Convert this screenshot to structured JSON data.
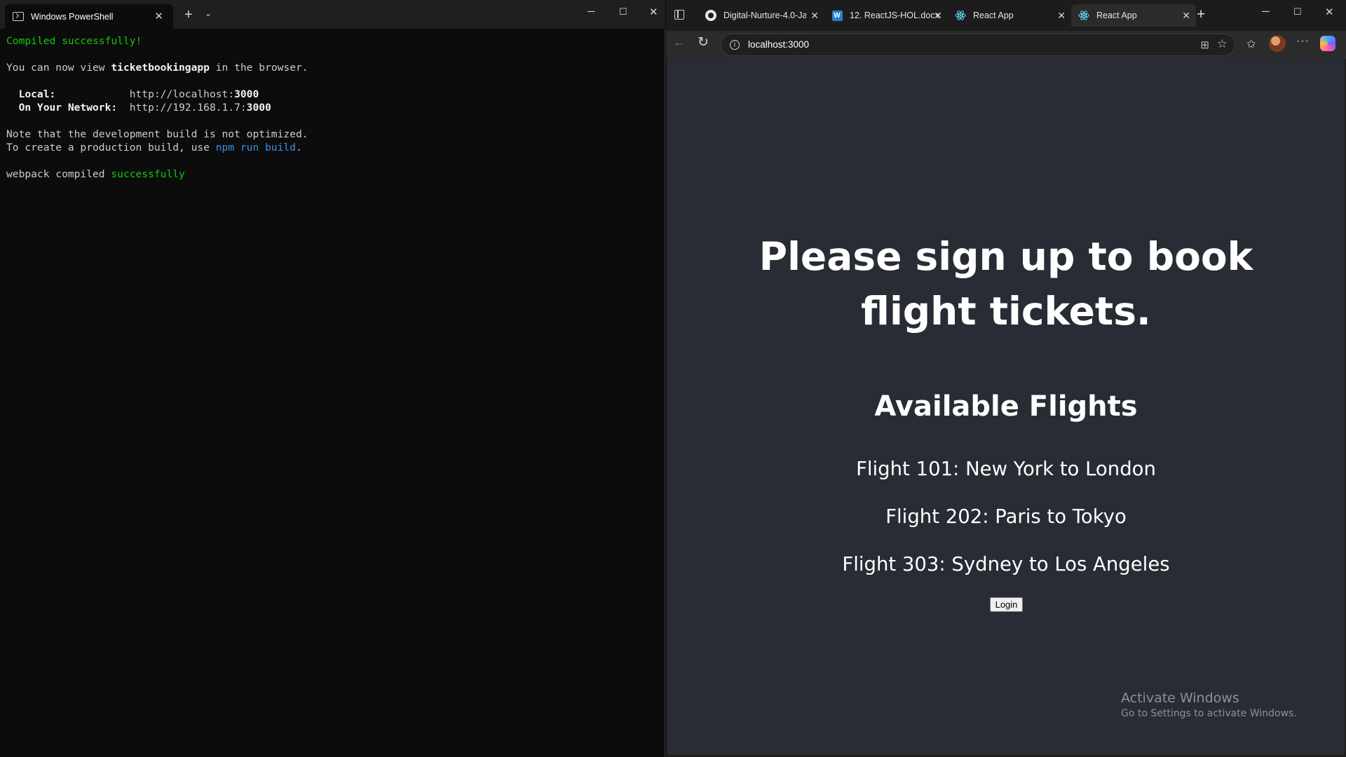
{
  "terminal": {
    "tab_title": "Windows PowerShell",
    "lines": {
      "compiled": "Compiled successfully!",
      "view_prefix": "You can now view ",
      "app_name": "ticketbookingapp",
      "view_suffix": " in the browser.",
      "local_label": "  Local:            ",
      "local_url_prefix": "http://localhost:",
      "local_port": "3000",
      "network_label": "  On Your Network:  ",
      "network_url_prefix": "http://192.168.1.7:",
      "network_port": "3000",
      "note1": "Note that the development build is not optimized.",
      "note2_prefix": "To create a production build, use ",
      "note2_cmd": "npm run build",
      "note2_suffix": ".",
      "webpack_prefix": "webpack compiled ",
      "webpack_status": "successfully"
    }
  },
  "browser": {
    "tabs": [
      {
        "label": "Digital-Nurture-4.0-Ja",
        "icon": "github-icon"
      },
      {
        "label": "12. ReactJS-HOL.docx",
        "icon": "word-icon"
      },
      {
        "label": "React App",
        "icon": "react-icon"
      },
      {
        "label": "React App",
        "icon": "react-icon",
        "active": true
      }
    ],
    "address": "localhost:3000",
    "page": {
      "heading": "Please sign up to book flight tickets.",
      "subheading": "Available Flights",
      "flights": [
        "Flight 101: New York to London",
        "Flight 202: Paris to Tokyo",
        "Flight 303: Sydney to Los Angeles"
      ],
      "login_label": "Login"
    },
    "watermark": {
      "title": "Activate Windows",
      "subtitle": "Go to Settings to activate Windows."
    }
  },
  "colors": {
    "terminal_bg": "#0c0c0c",
    "terminal_green": "#16c60c",
    "terminal_blue": "#3b8eea",
    "page_bg": "#282c34"
  }
}
